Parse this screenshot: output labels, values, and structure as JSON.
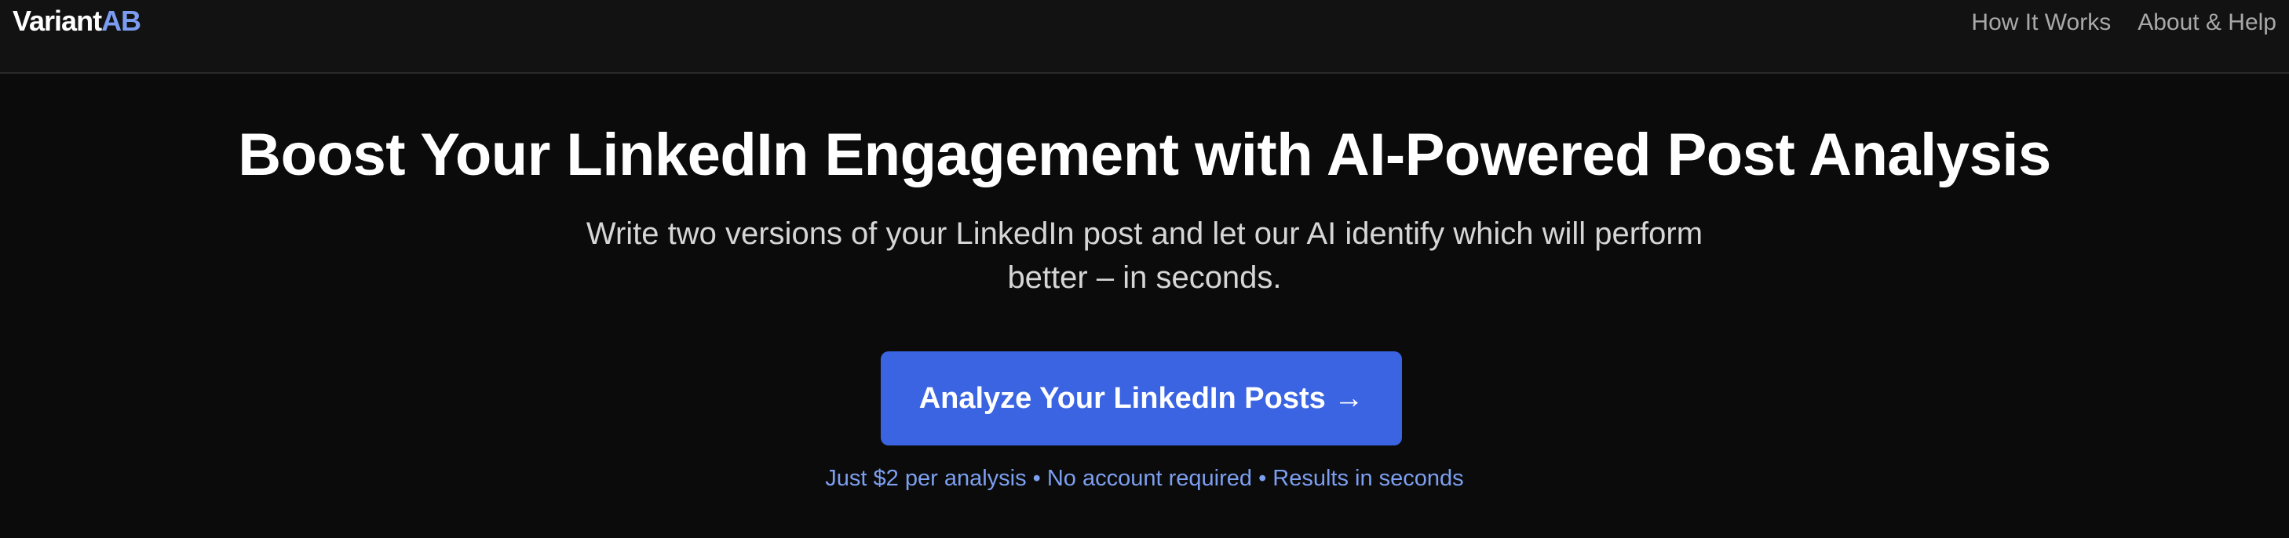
{
  "header": {
    "logo_main": "Variant",
    "logo_accent": "AB",
    "nav": [
      {
        "label": "How It Works"
      },
      {
        "label": "About & Help"
      }
    ]
  },
  "hero": {
    "headline": "Boost Your LinkedIn Engagement with AI-Powered Post Analysis",
    "subheadline": "Write two versions of your LinkedIn post and let our AI identify which will perform better – in seconds.",
    "cta_label": "Analyze Your LinkedIn Posts →",
    "note": "Just $2 per analysis • No account required • Results in seconds"
  },
  "colors": {
    "background": "#0b0b0b",
    "header_background": "#121212",
    "accent": "#3b64e3",
    "accent_text": "#7d9ff0"
  }
}
